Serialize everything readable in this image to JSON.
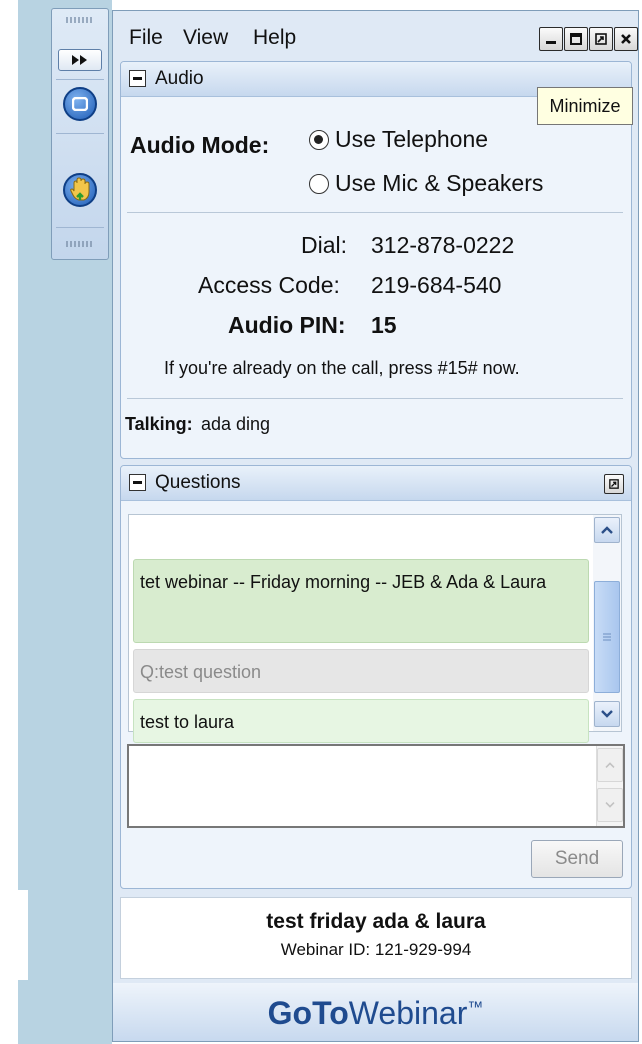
{
  "menu": {
    "file": "File",
    "view": "View",
    "help": "Help"
  },
  "tooltip": "Minimize",
  "audio": {
    "title": "Audio",
    "mode_label": "Audio Mode:",
    "options": [
      "Use Telephone",
      "Use Mic & Speakers"
    ],
    "selected": "Use Telephone",
    "dial_label": "Dial:",
    "dial_value": "312-878-0222",
    "access_label": "Access Code:",
    "access_value": "219-684-540",
    "pin_label": "Audio PIN:",
    "pin_value": "15",
    "note": "If you're already on the call, press #15# now.",
    "talking_label": "Talking:",
    "talking_value": "ada ding"
  },
  "questions": {
    "title": "Questions",
    "messages": [
      "tet webinar -- Friday morning -- JEB & Ada & Laura",
      "Q:test question",
      "test to laura"
    ],
    "send_label": "Send"
  },
  "webinar": {
    "name": "test friday ada & laura",
    "id_label": "Webinar ID: 121-929-994"
  },
  "brand": {
    "goto": "GoTo",
    "webinar": "Webinar",
    "tm": "™"
  },
  "colors": {
    "accent": "#1f4b8f",
    "message_green": "#d8eccf",
    "message_gray": "#e6e6e6",
    "message_light_green": "#e7f6e3"
  }
}
